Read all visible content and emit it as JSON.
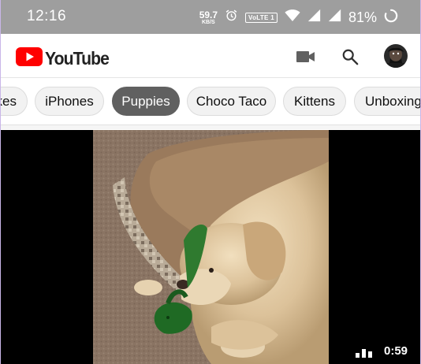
{
  "status_bar": {
    "time": "12:16",
    "net_speed": "59.7",
    "net_unit": "KB/S",
    "volte": "VoLTE 1",
    "battery_percent": "81%",
    "icons": [
      "alarm-icon",
      "wifi-icon",
      "signal-icon",
      "signal-icon-2",
      "battery-loading-icon"
    ]
  },
  "app_bar": {
    "brand": "YouTube",
    "icons": [
      "camera-icon",
      "search-icon",
      "avatar"
    ]
  },
  "chips": [
    {
      "label": "kes",
      "active": false
    },
    {
      "label": "iPhones",
      "active": false
    },
    {
      "label": "Puppies",
      "active": true
    },
    {
      "label": "Choco Taco",
      "active": false
    },
    {
      "label": "Kittens",
      "active": false
    },
    {
      "label": "Unboxing",
      "active": false
    }
  ],
  "video": {
    "duration": "0:59"
  },
  "colors": {
    "brand_red": "#ff0000",
    "status_bar": "#9e9e9e",
    "chip_active": "#606060",
    "chip_inactive": "#f2f2f2"
  }
}
